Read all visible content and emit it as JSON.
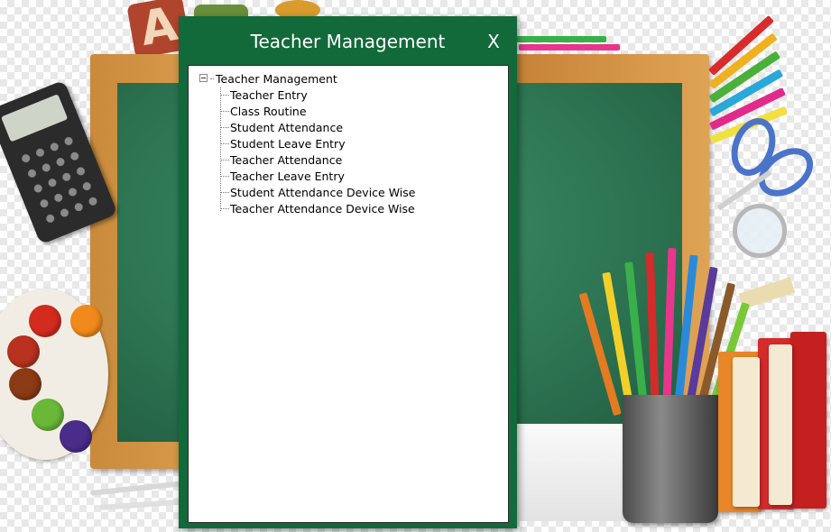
{
  "window": {
    "title": "Teacher Management",
    "close_label": "X"
  },
  "tree": {
    "root_label": "Teacher Management",
    "items": [
      {
        "label": "Teacher Entry"
      },
      {
        "label": "Class Routine"
      },
      {
        "label": "Student Attendance"
      },
      {
        "label": "Student Leave Entry"
      },
      {
        "label": "Teacher Attendance"
      },
      {
        "label": "Teacher Leave Entry"
      },
      {
        "label": "Student Attendance Device Wise"
      },
      {
        "label": "Teacher Attendance Device Wise"
      }
    ]
  },
  "colors": {
    "dialog_green": "#126a3a",
    "board_green": "#2e7654",
    "frame_wood": "#d4954a"
  }
}
